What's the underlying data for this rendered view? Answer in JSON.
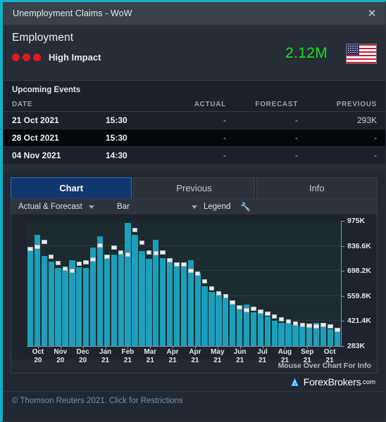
{
  "window": {
    "title": "Unemployment Claims - WoW",
    "close_icon": "close-icon"
  },
  "header": {
    "category": "Employment",
    "impact_label": "High Impact",
    "impact_dots": 3,
    "impact_color": "#e01b1b",
    "value": "2.12M",
    "value_color": "#1ee01e",
    "flag": "us-flag"
  },
  "events": {
    "section_title": "Upcoming Events",
    "columns": [
      "DATE",
      "",
      "ACTUAL",
      "FORECAST",
      "PREVIOUS"
    ],
    "rows": [
      {
        "date": "21 Oct 2021",
        "time": "15:30",
        "actual": "-",
        "forecast": "-",
        "previous": "293K",
        "highlighted": false
      },
      {
        "date": "28 Oct 2021",
        "time": "15:30",
        "actual": "-",
        "forecast": "-",
        "previous": "-",
        "highlighted": true
      },
      {
        "date": "04 Nov 2021",
        "time": "14:30",
        "actual": "-",
        "forecast": "-",
        "previous": "-",
        "highlighted": false
      }
    ]
  },
  "tabs": [
    {
      "label": "Chart",
      "active": true
    },
    {
      "label": "Previous",
      "active": false
    },
    {
      "label": "Info",
      "active": false
    }
  ],
  "chart_toolbar": {
    "series_select": "Actual & Forecast",
    "type_select": "Bar",
    "legend_label": "Legend",
    "tools_icon": "wrench-icon"
  },
  "chart_footer": {
    "mouse_hint": "Mouse Over Chart For Info"
  },
  "brand": {
    "name": "ForexBrokers",
    "suffix": ".com",
    "logo_icon": "forexbrokers-logo-icon"
  },
  "footer": {
    "copyright": "© Thomson Reuters 2021. Click for Restrictions"
  },
  "chart_data": {
    "type": "bar",
    "title": "Unemployment Claims - WoW",
    "xlabel": "",
    "ylabel": "",
    "ylim": [
      283000,
      975000
    ],
    "grid": true,
    "legend_position": "hidden",
    "ytick_labels": [
      "975K",
      "836.6K",
      "698.2K",
      "559.8K",
      "421.4K",
      "283K"
    ],
    "ytick_values": [
      975000,
      836600,
      698200,
      559800,
      421400,
      283000
    ],
    "xtick_labels": [
      "Oct\n20",
      "Nov\n20",
      "Dec\n20",
      "Jan\n21",
      "Feb\n21",
      "Mar\n21",
      "Apr\n21",
      "Apr\n21",
      "May\n21",
      "Jun\n21",
      "Jul\n21",
      "Aug\n21",
      "Sep\n21",
      "Oct\n21"
    ],
    "xtick_month": [
      "Oct",
      "Nov",
      "Dec",
      "Jan",
      "Feb",
      "Mar",
      "Apr",
      "Apr",
      "May",
      "Jun",
      "Jul",
      "Aug",
      "Sep",
      "Oct"
    ],
    "xtick_year": [
      "20",
      "20",
      "20",
      "21",
      "21",
      "21",
      "21",
      "21",
      "21",
      "21",
      "21",
      "21",
      "21",
      "21"
    ],
    "series": [
      {
        "name": "Actual",
        "color": "#1b9fba",
        "values": [
          822000,
          898000,
          781000,
          748000,
          716000,
          712000,
          757000,
          718000,
          716000,
          827000,
          888000,
          778000,
          787000,
          790000,
          965000,
          898000,
          806000,
          765000,
          869000,
          770000,
          760000,
          746000,
          726000,
          756000,
          688000,
          612000,
          584000,
          571000,
          546000,
          513000,
          486000,
          512000,
          470000,
          467000,
          446000,
          424000,
          411000,
          406000,
          398000,
          392000,
          386000,
          411000,
          408000,
          377000,
          362000
        ]
      },
      {
        "name": "Forecast",
        "color": "#e8ecef",
        "values": [
          820000,
          830000,
          860000,
          775000,
          740000,
          710000,
          700000,
          738000,
          745000,
          760000,
          840000,
          775000,
          828000,
          800000,
          790000,
          925000,
          855000,
          800000,
          795000,
          800000,
          758000,
          735000,
          735000,
          700000,
          685000,
          640000,
          600000,
          575000,
          560000,
          525000,
          498000,
          482000,
          490000,
          475000,
          460000,
          448000,
          430000,
          418000,
          408000,
          400000,
          396000,
          392000,
          400000,
          390000,
          372000
        ]
      }
    ]
  }
}
